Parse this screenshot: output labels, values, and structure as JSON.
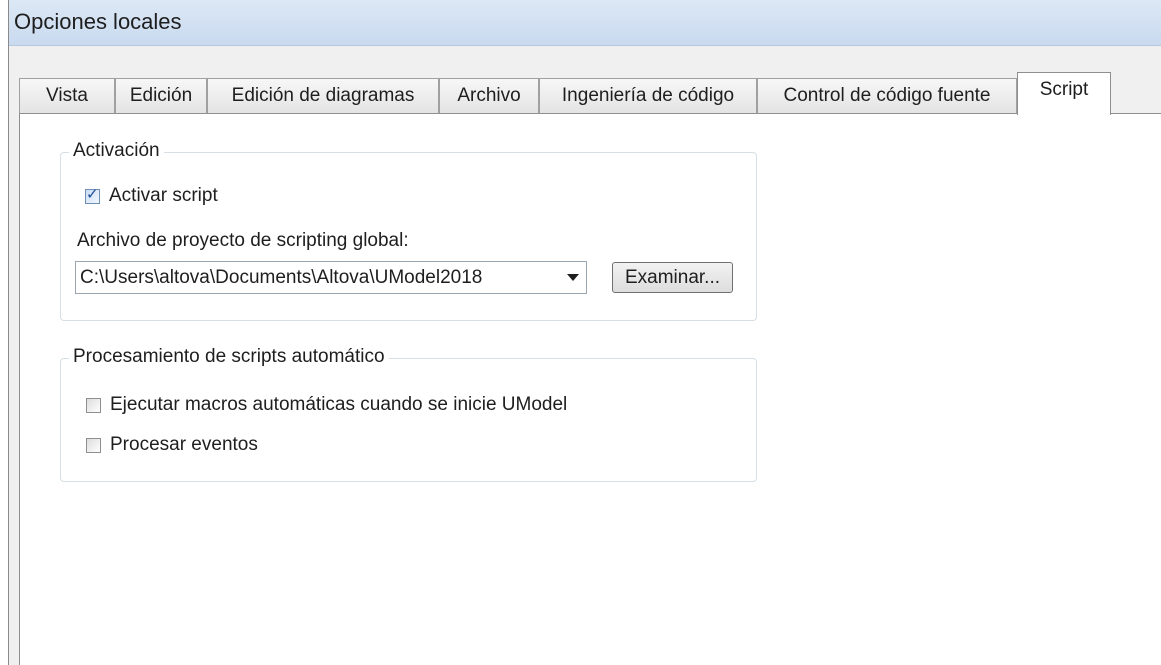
{
  "window": {
    "title": "Opciones locales"
  },
  "tabs": [
    {
      "label": "Vista",
      "active": false
    },
    {
      "label": "Edición",
      "active": false
    },
    {
      "label": "Edición de diagramas",
      "active": false
    },
    {
      "label": "Archivo",
      "active": false
    },
    {
      "label": "Ingeniería de código",
      "active": false
    },
    {
      "label": "Control de código fuente",
      "active": false
    },
    {
      "label": "Script",
      "active": true
    }
  ],
  "activation": {
    "legend": "Activación",
    "enable_script": {
      "label": "Activar script",
      "checked": true
    },
    "project_file_label": "Archivo de proyecto de scripting global:",
    "project_file_value": "C:\\Users\\altova\\Documents\\Altova\\UModel2018",
    "browse_button": "Examinar..."
  },
  "auto_processing": {
    "legend": "Procesamiento de scripts automático",
    "run_macros": {
      "label": "Ejecutar macros automáticas cuando se inicie UModel",
      "checked": false
    },
    "process_events": {
      "label": "Procesar eventos",
      "checked": false
    }
  },
  "icons": {
    "dropdown": "chevron-down-icon",
    "check": "checkmark-icon"
  },
  "colors": {
    "titlebar": "#c9daef",
    "dialog_background": "#f0f0f0",
    "panel_background": "#ffffff",
    "check_accent": "#1e4f9a"
  }
}
